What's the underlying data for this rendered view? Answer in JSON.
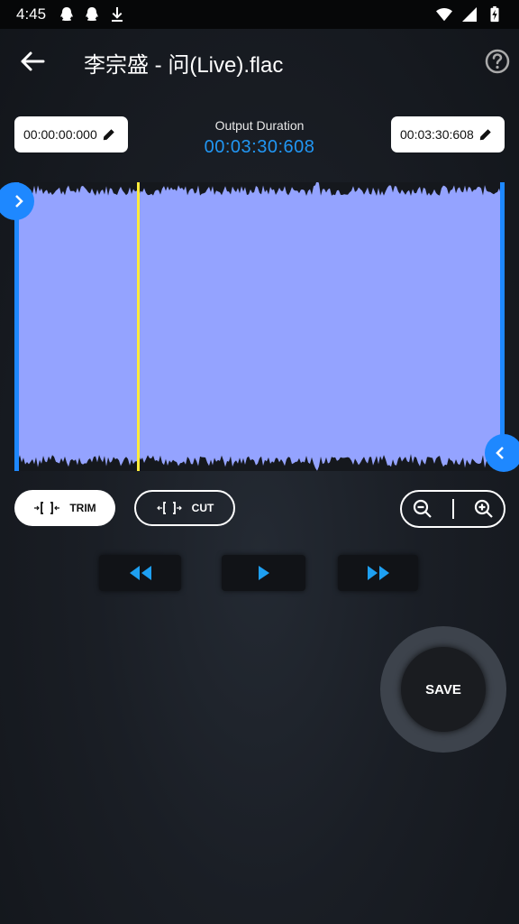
{
  "status_bar": {
    "time": "4:45",
    "left_icons": [
      "qq-icon",
      "qq-icon",
      "download-icon"
    ],
    "right_icons": [
      "wifi-icon",
      "signal-icon",
      "battery-charging-icon"
    ]
  },
  "app_bar": {
    "title": "李宗盛 - 问(Live).flac"
  },
  "times": {
    "start": "00:00:00:000",
    "end": "00:03:30:608",
    "output_label": "Output Duration",
    "output_value": "00:03:30:608"
  },
  "waveform": {
    "fill_color": "#94a3ff",
    "handle_color": "#1e88ff",
    "playhead_color": "#ffeb3b",
    "playhead_fraction": 0.25
  },
  "modes": {
    "trim_label": "TRIM",
    "cut_label": "CUT",
    "selected": "TRIM"
  },
  "transport": {
    "icon_color": "#1ea0f2"
  },
  "save": {
    "label": "SAVE"
  }
}
